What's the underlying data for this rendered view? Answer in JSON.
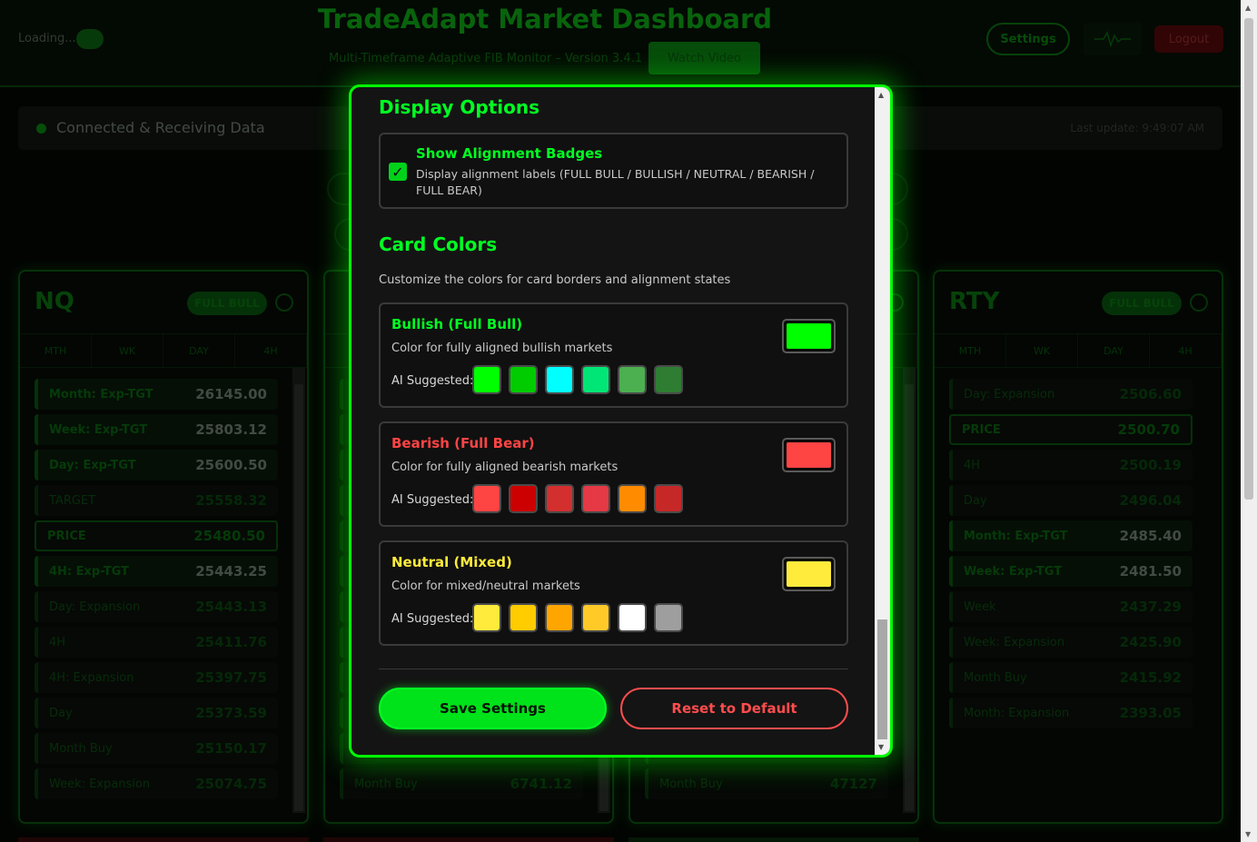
{
  "header": {
    "loading": "Loading...",
    "title": "TradeAdapt Market Dashboard",
    "subtitle": "Multi-Timeframe Adaptive FIB Monitor – Version 3.4.1",
    "watch_video": "Watch Video",
    "settings": "Settings",
    "logout": "Logout"
  },
  "status": {
    "text": "Connected & Receiving Data",
    "last_update": "Last update: 9:49:07 AM"
  },
  "cards": [
    {
      "symbol": "NQ",
      "badge": "FULL BULL",
      "tabs": [
        "MTH",
        "WK",
        "DAY",
        "4H"
      ],
      "levels": [
        {
          "name": "Month: Exp-TGT",
          "value": "26145.00",
          "style": "hi"
        },
        {
          "name": "Week: Exp-TGT",
          "value": "25803.12",
          "style": "hi"
        },
        {
          "name": "Day: Exp-TGT",
          "value": "25600.50",
          "style": "hi"
        },
        {
          "name": "TARGET",
          "value": "25558.32",
          "style": "dim"
        },
        {
          "name": "PRICE",
          "value": "25480.50",
          "style": "price"
        },
        {
          "name": "4H: Exp-TGT",
          "value": "25443.25",
          "style": "hi"
        },
        {
          "name": "Day: Expansion",
          "value": "25443.13",
          "style": "dim"
        },
        {
          "name": "4H",
          "value": "25411.76",
          "style": "dim"
        },
        {
          "name": "4H: Expansion",
          "value": "25397.75",
          "style": "dim"
        },
        {
          "name": "Day",
          "value": "25373.59",
          "style": "dim"
        },
        {
          "name": "Month Buy",
          "value": "25150.17",
          "style": "dim"
        },
        {
          "name": "Week: Expansion",
          "value": "25074.75",
          "style": "dim"
        }
      ]
    },
    {
      "symbol": "",
      "badge": "",
      "tabs": [
        "",
        "",
        "",
        ""
      ],
      "levels": [
        {
          "name": "",
          "value": "",
          "style": "dim"
        },
        {
          "name": "",
          "value": "",
          "style": "dim"
        },
        {
          "name": "",
          "value": "",
          "style": "dim"
        },
        {
          "name": "",
          "value": "",
          "style": "dim"
        },
        {
          "name": "",
          "value": "",
          "style": "dim"
        },
        {
          "name": "",
          "value": "",
          "style": "dim"
        },
        {
          "name": "",
          "value": "",
          "style": "dim"
        },
        {
          "name": "",
          "value": "",
          "style": "dim"
        },
        {
          "name": "",
          "value": "",
          "style": "dim"
        },
        {
          "name": "",
          "value": "",
          "style": "dim"
        },
        {
          "name": "",
          "value": "",
          "style": "dim"
        },
        {
          "name": "Month Buy",
          "value": "6741.12",
          "style": "dim"
        }
      ]
    },
    {
      "symbol": "",
      "badge": "",
      "tabs": [
        "",
        "",
        "",
        ""
      ],
      "levels": [
        {
          "name": "",
          "value": "",
          "style": "dim"
        },
        {
          "name": "",
          "value": "",
          "style": "dim"
        },
        {
          "name": "",
          "value": "",
          "style": "dim"
        },
        {
          "name": "",
          "value": "",
          "style": "dim"
        },
        {
          "name": "",
          "value": "",
          "style": "dim"
        },
        {
          "name": "",
          "value": "",
          "style": "dim"
        },
        {
          "name": "",
          "value": "",
          "style": "dim"
        },
        {
          "name": "",
          "value": "",
          "style": "dim"
        },
        {
          "name": "",
          "value": "",
          "style": "dim"
        },
        {
          "name": "",
          "value": "",
          "style": "dim"
        },
        {
          "name": "",
          "value": "",
          "style": "dim"
        },
        {
          "name": "Month Buy",
          "value": "47127",
          "style": "dim"
        }
      ]
    },
    {
      "symbol": "RTY",
      "badge": "FULL BULL",
      "tabs": [
        "MTH",
        "WK",
        "DAY",
        "4H"
      ],
      "levels": [
        {
          "name": "Day: Expansion",
          "value": "2506.60",
          "style": "dim"
        },
        {
          "name": "PRICE",
          "value": "2500.70",
          "style": "price"
        },
        {
          "name": "4H",
          "value": "2500.19",
          "style": "dim"
        },
        {
          "name": "Day",
          "value": "2496.04",
          "style": "dim"
        },
        {
          "name": "Month: Exp-TGT",
          "value": "2485.40",
          "style": "hi"
        },
        {
          "name": "Week: Exp-TGT",
          "value": "2481.50",
          "style": "hi"
        },
        {
          "name": "Week",
          "value": "2437.29",
          "style": "dim"
        },
        {
          "name": "Week: Expansion",
          "value": "2425.90",
          "style": "dim"
        },
        {
          "name": "Month Buy",
          "value": "2415.92",
          "style": "dim"
        },
        {
          "name": "Month: Expansion",
          "value": "2393.05",
          "style": "dim"
        }
      ]
    }
  ],
  "modal": {
    "display_options_title": "Display Options",
    "show_badges": {
      "checked": true,
      "label": "Show Alignment Badges",
      "description": "Display alignment labels (FULL BULL / BULLISH / NEUTRAL / BEARISH / FULL BEAR)"
    },
    "card_colors_title": "Card Colors",
    "card_colors_desc": "Customize the colors for card borders and alignment states",
    "ai_label": "AI Suggested:",
    "color_groups": [
      {
        "title": "Bullish (Full Bull)",
        "title_color": "#00ff22",
        "description": "Color for fully aligned bullish markets",
        "current": "#00ff00",
        "suggested": [
          "#00ff00",
          "#00cc00",
          "#00ffff",
          "#00e676",
          "#4caf50",
          "#2e7d32"
        ]
      },
      {
        "title": "Bearish (Full Bear)",
        "title_color": "#ff4444",
        "description": "Color for fully aligned bearish markets",
        "current": "#ff4444",
        "suggested": [
          "#ff4444",
          "#cc0000",
          "#d32f2f",
          "#e53945",
          "#ff8c00",
          "#c62828"
        ]
      },
      {
        "title": "Neutral (Mixed)",
        "title_color": "#ffeb3b",
        "description": "Color for mixed/neutral markets",
        "current": "#ffeb3b",
        "suggested": [
          "#ffeb3b",
          "#ffcc00",
          "#ffa500",
          "#ffca28",
          "#ffffff",
          "#9e9e9e"
        ]
      }
    ],
    "save_label": "Save Settings",
    "reset_label": "Reset to Default"
  }
}
